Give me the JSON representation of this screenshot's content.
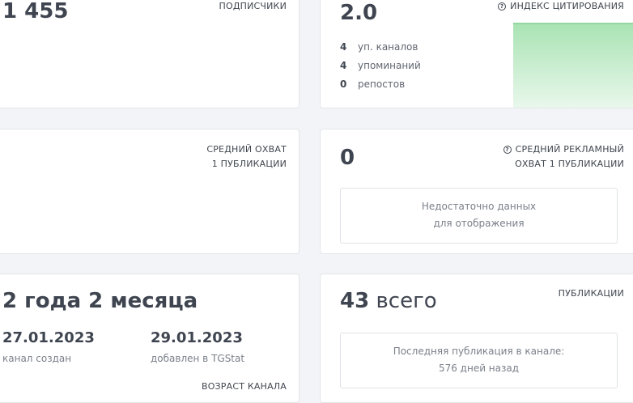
{
  "subscribers": {
    "value": "1 455",
    "caption": "ПОДПИСЧИКИ"
  },
  "citation": {
    "value": "2.0",
    "caption": "ИНДЕКС ЦИТИРОВАНИЯ",
    "stats": [
      {
        "num": "4",
        "label": "уп. каналов"
      },
      {
        "num": "4",
        "label": "упоминаний"
      },
      {
        "num": "0",
        "label": "репостов"
      }
    ]
  },
  "avg_reach": {
    "caption_line1": "СРЕДНИЙ ОХВАТ",
    "caption_line2": "1 ПУБЛИКАЦИИ"
  },
  "ad_reach": {
    "value": "0",
    "caption_line1": "СРЕДНИЙ РЕКЛАМНЫЙ",
    "caption_line2": "ОХВАТ 1 ПУБЛИКАЦИИ",
    "nodata_line1": "Недостаточно данных",
    "nodata_line2": "для отображения"
  },
  "age": {
    "value": "2 года 2 месяца",
    "created_date": "27.01.2023",
    "created_label": "канал создан",
    "added_date": "29.01.2023",
    "added_label": "добавлен в TGStat",
    "caption": "ВОЗРАСТ КАНАЛА"
  },
  "posts": {
    "count": "43",
    "count_suffix": "всего",
    "caption": "ПУБЛИКАЦИИ",
    "last_line1": "Последняя публикация в канале:",
    "last_line2": "576 дней назад"
  },
  "colors": {
    "chart_green_top": "#a9e3b3",
    "chart_green_bottom": "#e9f8ec",
    "chart_line": "#7fcf8f"
  },
  "icons": {
    "help": "help-circle-icon"
  }
}
